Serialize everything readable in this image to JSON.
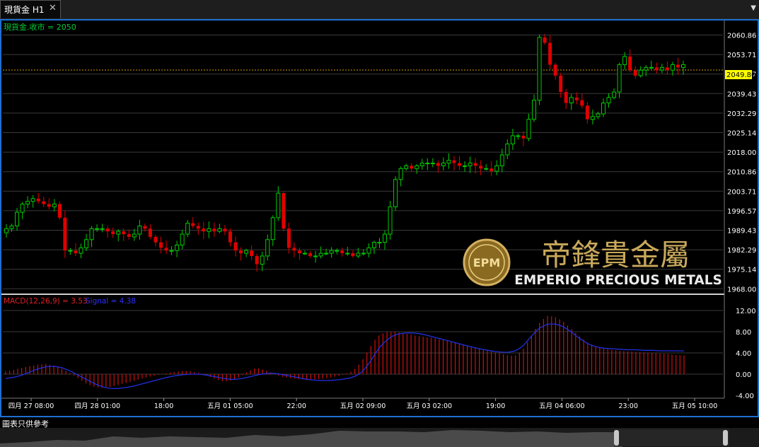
{
  "tab": {
    "title": "現貨金 H1",
    "close": "✕",
    "menu_arrow": "▼"
  },
  "price_pane": {
    "legend": "現貨金.收市 = 2050",
    "current_price": "2049.80",
    "y_ticks": [
      "2060.86",
      "2053.71",
      "2046.57",
      "2039.43",
      "2032.29",
      "2025.14",
      "2018.00",
      "2010.86",
      "2003.71",
      "1996.57",
      "1989.43",
      "1982.29",
      "1975.14",
      "1968.00"
    ]
  },
  "watermark": {
    "chinese": "帝鋒貴金屬",
    "english": "EMPERIO PRECIOUS METALS",
    "logo_letters": "EPM"
  },
  "macd_pane": {
    "legend_macd": "MACD(12,26,9) = 3.53",
    "legend_signal": "Signal = 4.38",
    "y_ticks": [
      "12.00",
      "8.00",
      "4.00",
      "0.00",
      "-4.00"
    ]
  },
  "x_axis": [
    "四月 27 08:00",
    "四月 28 01:00",
    "18:00",
    "五月 01 05:00",
    "22:00",
    "五月 02 09:00",
    "五月 03 02:00",
    "19:00",
    "五月 04 06:00",
    "23:00",
    "五月 05 10:00"
  ],
  "footer": {
    "note": "圖表只供參考"
  },
  "colors": {
    "up": "#00cc00",
    "down": "#e00000",
    "macd_hist": "#d01010",
    "signal": "#2020e0",
    "current_price_bg": "#ffff00",
    "legend_green": "#00cc33",
    "frame": "#1e6fd0"
  },
  "chart_data": {
    "type": "candlestick",
    "symbol": "現貨金",
    "timeframe": "H1",
    "y_range": [
      1968.0,
      2064.0
    ],
    "x_labels": [
      "四月 27 08:00",
      "四月 28 01:00",
      "18:00",
      "五月 01 05:00",
      "22:00",
      "五月 02 09:00",
      "五月 03 02:00",
      "19:00",
      "五月 04 06:00",
      "23:00",
      "五月 05 10:00"
    ],
    "close_anchors": [
      1990,
      1991,
      1996,
      1999,
      2000,
      2001,
      2000,
      1999,
      1998,
      1999,
      1994,
      1982,
      1982,
      1981,
      1983,
      1986,
      1990,
      1990,
      1990,
      1989,
      1988,
      1989,
      1988,
      1987,
      1988,
      1991,
      1990,
      1987,
      1985,
      1983,
      1982,
      1982,
      1984,
      1988,
      1992,
      1991,
      1990,
      1989,
      1990,
      1989,
      1990,
      1989,
      1985,
      1982,
      1981,
      1982,
      1980,
      1977,
      1980,
      1986,
      1994,
      2003,
      1990,
      1983,
      1982,
      1981,
      1981,
      1980,
      1980,
      1981,
      1981,
      1982,
      1982,
      1981,
      1981,
      1980,
      1981,
      1981,
      1983,
      1985,
      1985,
      1988,
      1998,
      2008,
      2012,
      2013,
      2012,
      2013,
      2014,
      2014,
      2014,
      2013,
      2014,
      2015,
      2014,
      2013,
      2013,
      2014,
      2013,
      2012,
      2012,
      2011,
      2013,
      2017,
      2021,
      2024,
      2024,
      2023,
      2030,
      2037,
      2060,
      2058,
      2050,
      2046,
      2040,
      2036,
      2038,
      2037,
      2035,
      2030,
      2031,
      2032,
      2036,
      2038,
      2040,
      2050,
      2053,
      2048,
      2046,
      2048,
      2049,
      2049,
      2048,
      2049,
      2048,
      2050,
      2049,
      2050
    ],
    "macd": {
      "histogram_anchors": [
        0.5,
        0.8,
        1.2,
        1.5,
        1.8,
        1.9,
        1.6,
        1.0,
        0.2,
        -0.8,
        -1.8,
        -2.4,
        -2.6,
        -2.4,
        -2.0,
        -1.6,
        -1.2,
        -0.8,
        -0.4,
        -0.1,
        0.2,
        0.4,
        0.6,
        0.5,
        0.2,
        -0.3,
        -0.9,
        -1.4,
        -1.2,
        -0.5,
        0.5,
        1.2,
        0.8,
        0.2,
        -0.4,
        -0.7,
        -0.9,
        -1.0,
        -1.0,
        -0.9,
        -0.7,
        -0.4,
        0.0,
        0.6,
        2.2,
        4.8,
        7.1,
        7.9,
        8.0,
        7.8,
        7.5,
        7.2,
        7.0,
        6.8,
        6.5,
        6.2,
        5.8,
        5.4,
        5.0,
        4.6,
        4.3,
        4.0,
        3.6,
        3.4,
        4.5,
        7.0,
        9.5,
        11.0,
        10.8,
        10.0,
        8.6,
        7.2,
        6.0,
        5.2,
        4.8,
        4.6,
        4.4,
        4.3,
        4.2,
        4.1,
        4.0,
        3.9,
        3.8,
        3.6,
        3.53
      ],
      "signal_anchors": [
        -0.8,
        -0.6,
        -0.2,
        0.4,
        1.0,
        1.4,
        1.5,
        1.2,
        0.6,
        -0.2,
        -1.0,
        -1.8,
        -2.4,
        -2.7,
        -2.7,
        -2.5,
        -2.2,
        -1.8,
        -1.4,
        -1.0,
        -0.6,
        -0.3,
        -0.1,
        0.0,
        0.0,
        -0.2,
        -0.5,
        -0.8,
        -1.0,
        -0.9,
        -0.6,
        -0.2,
        0.1,
        0.2,
        0.0,
        -0.3,
        -0.6,
        -0.9,
        -1.1,
        -1.2,
        -1.2,
        -1.1,
        -0.9,
        -0.6,
        0.2,
        2.0,
        4.5,
        6.2,
        7.3,
        7.7,
        7.8,
        7.7,
        7.4,
        7.0,
        6.6,
        6.2,
        5.8,
        5.4,
        5.0,
        4.7,
        4.4,
        4.2,
        4.1,
        4.3,
        5.2,
        7.0,
        8.6,
        9.4,
        9.5,
        9.0,
        8.0,
        6.8,
        5.8,
        5.2,
        4.9,
        4.8,
        4.7,
        4.6,
        4.6,
        4.5,
        4.5,
        4.4,
        4.4,
        4.4,
        4.38
      ],
      "y_range": [
        -4.0,
        12.0
      ]
    }
  }
}
